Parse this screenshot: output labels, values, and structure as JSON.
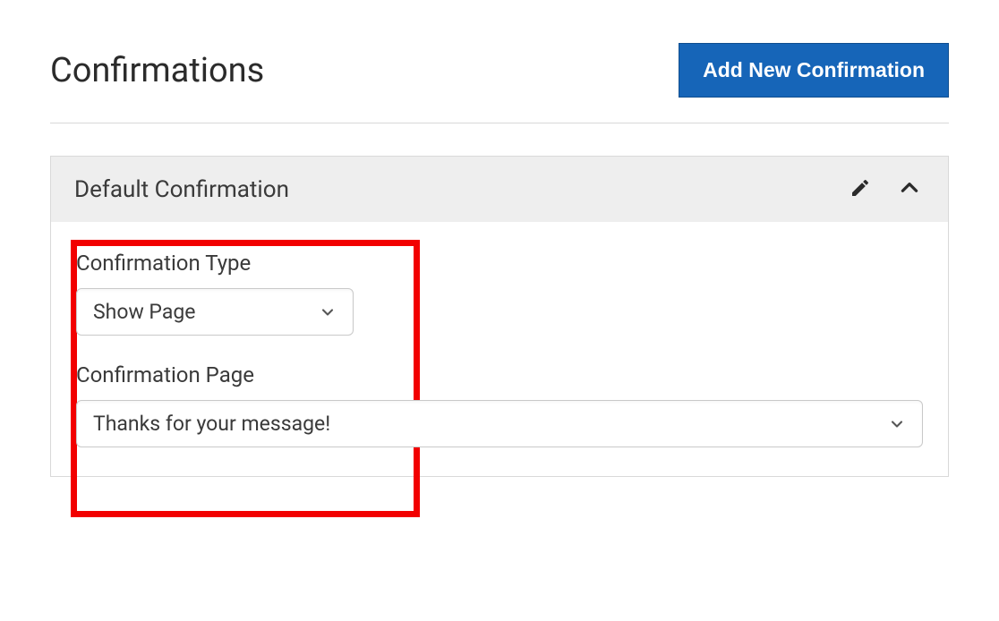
{
  "header": {
    "title": "Confirmations",
    "add_button_label": "Add New Confirmation"
  },
  "panel": {
    "title": "Default Confirmation",
    "fields": {
      "confirmation_type": {
        "label": "Confirmation Type",
        "selected": "Show Page"
      },
      "confirmation_page": {
        "label": "Confirmation Page",
        "selected": "Thanks for your message!"
      }
    }
  }
}
